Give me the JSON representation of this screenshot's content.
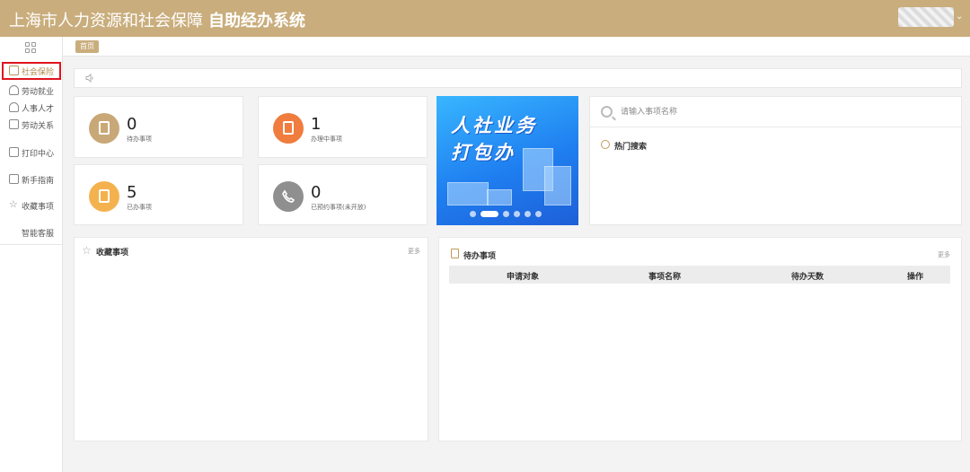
{
  "header": {
    "title_prefix": "上海市人力资源和社会保障",
    "title_bold": "自助经办系统"
  },
  "sidebar": {
    "items": [
      {
        "label": "社会保险",
        "icon": "shield-icon",
        "active": true
      },
      {
        "label": "劳动就业",
        "icon": "person-icon"
      },
      {
        "label": "人事人才",
        "icon": "people-icon"
      },
      {
        "label": "劳动关系",
        "icon": "document-icon"
      },
      {
        "label": "打印中心",
        "icon": "printer-icon"
      },
      {
        "label": "新手指南",
        "icon": "guide-icon"
      },
      {
        "label": "收藏事项",
        "icon": "star-icon"
      },
      {
        "label": "智能客服",
        "icon": "chat-icon"
      }
    ]
  },
  "breadcrumb": {
    "home": "首页"
  },
  "stats": [
    {
      "value": "0",
      "label": "待办事项",
      "color": "#c9a878"
    },
    {
      "value": "1",
      "label": "办理中事项",
      "color": "#f07c3e"
    },
    {
      "value": "5",
      "label": "已办事项",
      "color": "#f4b24f"
    },
    {
      "value": "0",
      "label": "已预约事项(未开放)",
      "color": "#8f8f8f"
    }
  ],
  "banner": {
    "line1": "人社业务",
    "line2": "打包办",
    "slides": 6,
    "active_slide": 2
  },
  "search": {
    "placeholder": "请输入事项名称",
    "hot_label": "热门搜索"
  },
  "favorites": {
    "title": "收藏事项",
    "more": "更多"
  },
  "todo": {
    "title": "待办事项",
    "more": "更多",
    "columns": [
      "申请对象",
      "事项名称",
      "待办天数",
      "操作"
    ]
  },
  "colors": {
    "brand": "#c9ad7c",
    "highlight": "#e0141e",
    "accent_text": "#b08a4e"
  }
}
